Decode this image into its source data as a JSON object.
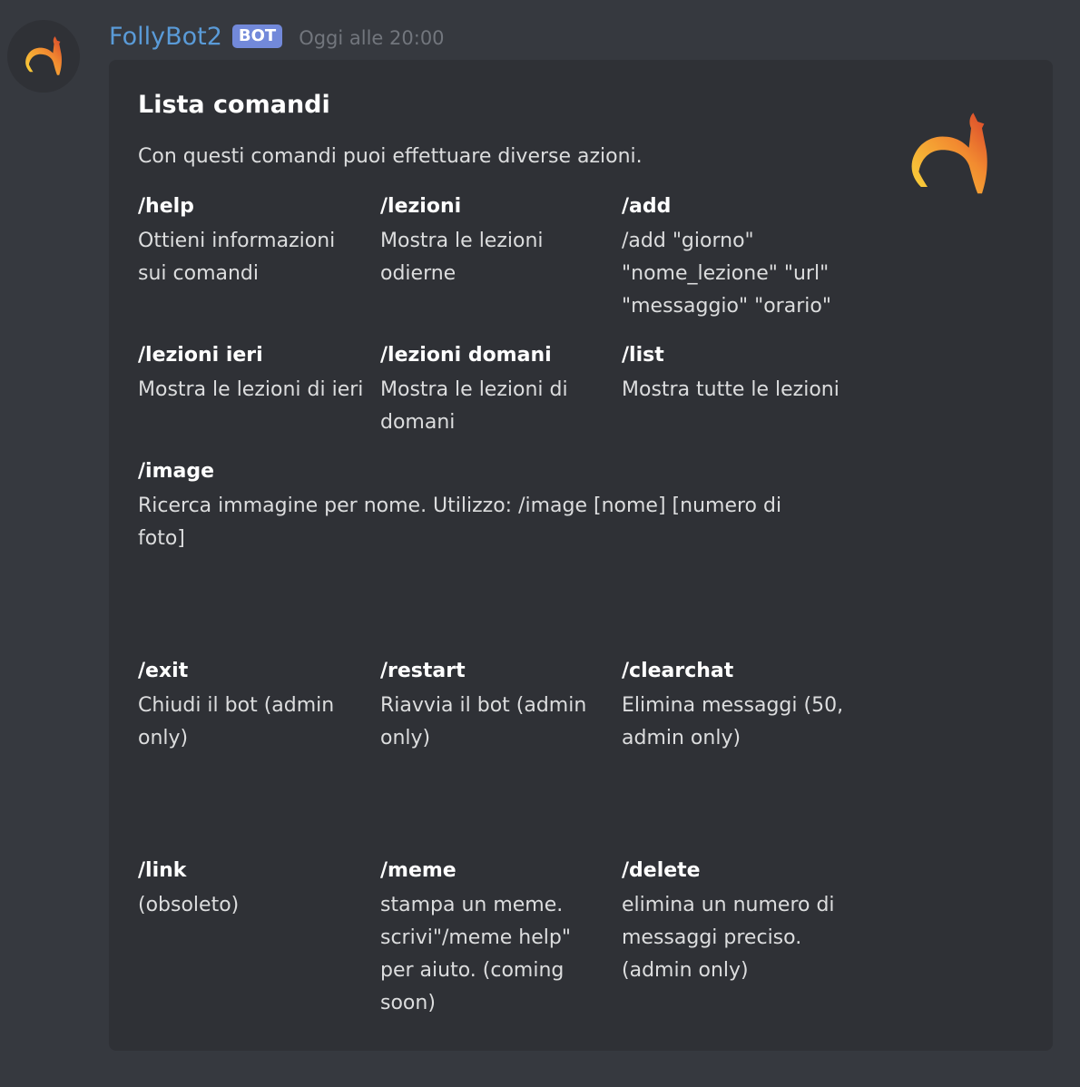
{
  "message": {
    "username": "FollyBot2",
    "bot_tag": "BOT",
    "timestamp": "Oggi alle 20:00",
    "avatar_icon": "llama-icon"
  },
  "embed": {
    "title": "Lista comandi",
    "description": "Con questi comandi puoi effettuare diverse azioni.",
    "thumbnail_icon": "llama-icon",
    "accent_colors": [
      "#f9d63b",
      "#f28b30",
      "#d9452b"
    ],
    "fields": [
      {
        "name": "/help",
        "value": "Ottieni informazioni sui comandi"
      },
      {
        "name": "/lezioni",
        "value": "Mostra le lezioni odierne"
      },
      {
        "name": "/add",
        "value": "/add \"giorno\" \"nome_lezione\" \"url\" \"messaggio\" \"orario\""
      },
      {
        "name": "/lezioni ieri",
        "value": "Mostra le lezioni di ieri"
      },
      {
        "name": "/lezioni domani",
        "value": "Mostra le lezioni di domani"
      },
      {
        "name": "/list",
        "value": "Mostra tutte le lezioni"
      },
      {
        "name": "/image",
        "value": "Ricerca immagine per nome. Utilizzo: /image [nome] [numero di foto]"
      },
      {
        "name": "/exit",
        "value": "Chiudi il bot (admin only)"
      },
      {
        "name": "/restart",
        "value": "Riavvia il bot (admin only)"
      },
      {
        "name": "/clearchat",
        "value": "Elimina messaggi (50, admin only)"
      },
      {
        "name": "/link",
        "value": "(obsoleto)"
      },
      {
        "name": "/meme",
        "value": "stampa un meme. scrivi\"/meme help\" per aiuto. (coming soon)"
      },
      {
        "name": "/delete",
        "value": "elimina un numero di messaggi preciso. (admin only)"
      }
    ]
  }
}
